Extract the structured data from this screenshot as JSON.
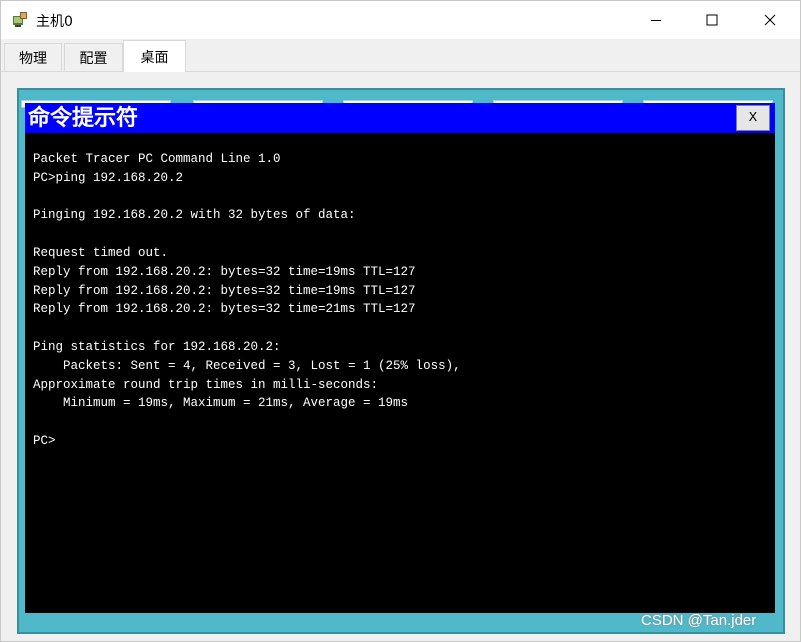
{
  "window": {
    "title": "主机0",
    "app_icon": "packet-tracer-pc-icon",
    "controls": {
      "minimize": "minimize-icon",
      "maximize": "maximize-icon",
      "close": "close-icon"
    }
  },
  "tabs": [
    {
      "label": "物理",
      "selected": false
    },
    {
      "label": "配置",
      "selected": false
    },
    {
      "label": "桌面",
      "selected": true
    }
  ],
  "command_prompt": {
    "title": "命令提示符",
    "close_label": "X",
    "title_bar_color": "#0000ff",
    "output_text": "Packet Tracer PC Command Line 1.0\nPC>ping 192.168.20.2\n\nPinging 192.168.20.2 with 32 bytes of data:\n\nRequest timed out.\nReply from 192.168.20.2: bytes=32 time=19ms TTL=127\nReply from 192.168.20.2: bytes=32 time=19ms TTL=127\nReply from 192.168.20.2: bytes=32 time=21ms TTL=127\n\nPing statistics for 192.168.20.2:\n    Packets: Sent = 4, Received = 3, Lost = 1 (25% loss),\nApproximate round trip times in milli-seconds:\n    Minimum = 19ms, Maximum = 21ms, Average = 19ms\n\nPC>"
  },
  "watermark": "CSDN @Tan.jder",
  "colors": {
    "desktop_background": "#4fb8c9",
    "terminal_background": "#000000",
    "terminal_text": "#ffffff"
  }
}
